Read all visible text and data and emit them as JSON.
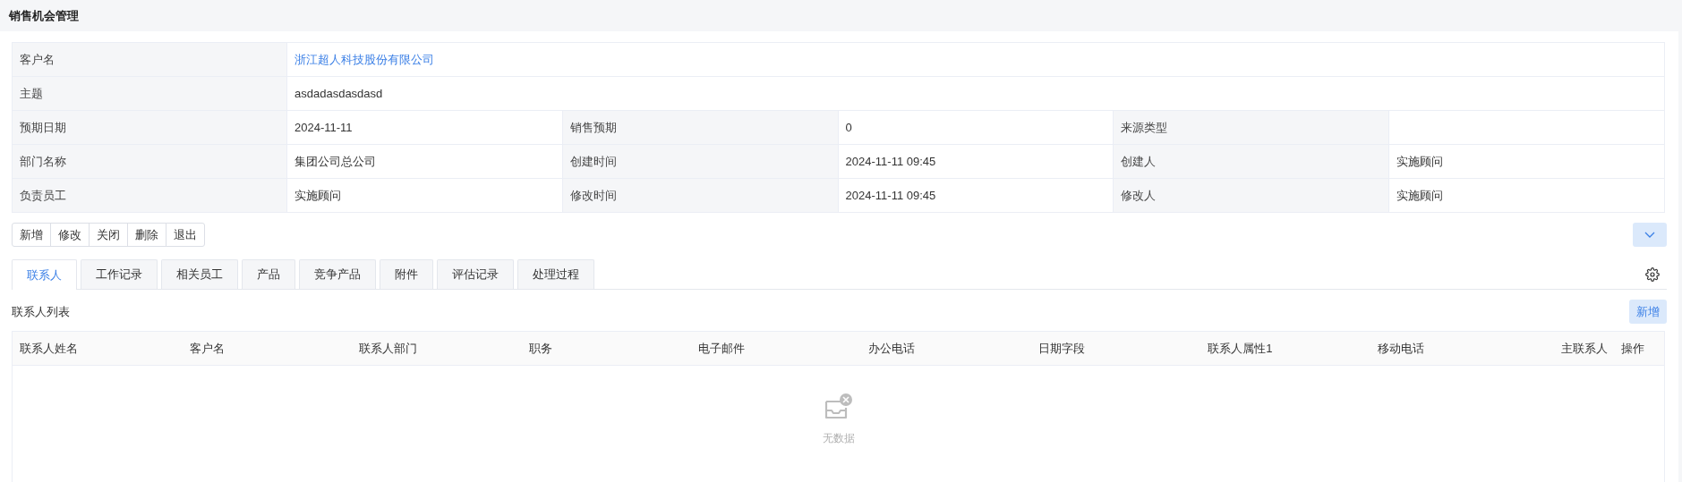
{
  "page_title": "销售机会管理",
  "details": {
    "rows": [
      [
        {
          "label": "客户名",
          "value": "浙江超人科技股份有限公司",
          "kind": "link"
        }
      ],
      [
        {
          "label": "主题",
          "value": "asdadasdasdasd",
          "kind": "text"
        }
      ],
      [
        {
          "label": "预期日期",
          "value": "2024-11-11",
          "kind": "text"
        },
        {
          "label": "销售预期",
          "value": "0",
          "kind": "text"
        },
        {
          "label": "来源类型",
          "kind": "text"
        }
      ],
      [
        {
          "label": "部门名称",
          "value": "集团公司总公司",
          "kind": "text"
        },
        {
          "label": "创建时间",
          "value": "2024-11-11 09:45",
          "kind": "text"
        },
        {
          "label": "创建人",
          "value": "实施顾问",
          "kind": "text"
        }
      ],
      [
        {
          "label": "负责员工",
          "value": "实施顾问",
          "kind": "text"
        },
        {
          "label": "修改时间",
          "value": "2024-11-11 09:45",
          "kind": "text"
        },
        {
          "label": "修改人",
          "value": "实施顾问",
          "kind": "text"
        }
      ]
    ]
  },
  "actions": [
    "新增",
    "修改",
    "关闭",
    "删除",
    "退出"
  ],
  "tabs": [
    {
      "label": "联系人",
      "selected": true
    },
    {
      "label": "工作记录",
      "selected": false
    },
    {
      "label": "相关员工",
      "selected": false
    },
    {
      "label": "产品",
      "selected": false
    },
    {
      "label": "竞争产品",
      "selected": false
    },
    {
      "label": "附件",
      "selected": false
    },
    {
      "label": "评估记录",
      "selected": false
    },
    {
      "label": "处理过程",
      "selected": false
    }
  ],
  "list": {
    "title": "联系人列表",
    "add_button": "新增",
    "table": {
      "columns": [
        "联系人姓名",
        "客户名",
        "联系人部门",
        "职务",
        "电子邮件",
        "办公电话",
        "日期字段",
        "联系人属性1",
        "移动电话",
        "主联系人",
        "操作"
      ],
      "empty_text": "无数据"
    }
  }
}
